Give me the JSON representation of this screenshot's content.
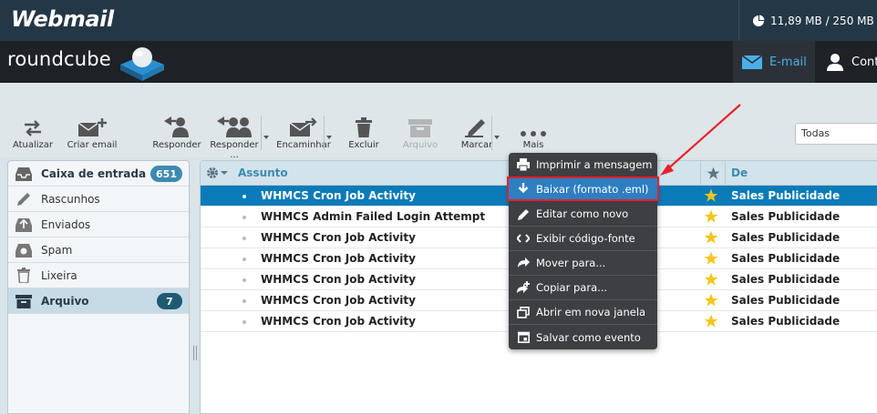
{
  "topbar": {
    "brand": "Webmail",
    "quota": "11,89 MB / 250 MB"
  },
  "header": {
    "logo": "roundcube",
    "nav_mail": "E-mail",
    "nav_contacts": "Cont"
  },
  "toolbar": {
    "refresh": "Atualizar",
    "compose": "Criar email",
    "reply": "Responder",
    "reply_all": "Responder ...",
    "forward": "Encaminhar",
    "delete": "Excluir",
    "archive": "Arquivo",
    "mark": "Marcar",
    "more": "Mais",
    "filter": "Todas"
  },
  "folders": [
    {
      "label": "Caixa de entrada",
      "count": "651",
      "icon": "inbox-icon"
    },
    {
      "label": "Rascunhos",
      "icon": "pencil-icon"
    },
    {
      "label": "Enviados",
      "icon": "sent-icon"
    },
    {
      "label": "Spam",
      "icon": "spam-icon"
    },
    {
      "label": "Lixeira",
      "icon": "trash-icon"
    },
    {
      "label": "Arquivo",
      "count": "7",
      "icon": "archive-icon"
    }
  ],
  "list": {
    "col_subject": "Assunto",
    "col_from": "De",
    "rows": [
      {
        "subject": "WHMCS Cron Job Activity",
        "from": "Sales Publicidade"
      },
      {
        "subject": "WHMCS Admin Failed Login Attempt",
        "from": "Sales Publicidade"
      },
      {
        "subject": "WHMCS Cron Job Activity",
        "from": "Sales Publicidade"
      },
      {
        "subject": "WHMCS Cron Job Activity",
        "from": "Sales Publicidade"
      },
      {
        "subject": "WHMCS Cron Job Activity",
        "from": "Sales Publicidade"
      },
      {
        "subject": "WHMCS Cron Job Activity",
        "from": "Sales Publicidade"
      },
      {
        "subject": "WHMCS Cron Job Activity",
        "from": "Sales Publicidade"
      }
    ]
  },
  "menu": [
    {
      "label": "Imprimir a mensagem",
      "icon": "print-icon"
    },
    {
      "label": "Baixar (formato .eml)",
      "icon": "download-icon"
    },
    {
      "label": "Editar como novo",
      "icon": "edit-icon"
    },
    {
      "label": "Exibir código-fonte",
      "icon": "code-icon"
    },
    {
      "label": "Mover para...",
      "icon": "move-icon"
    },
    {
      "label": "Copiar para...",
      "icon": "copy-icon"
    },
    {
      "label": "Abrir em nova janela",
      "icon": "new-window-icon"
    },
    {
      "label": "Salvar como evento",
      "icon": "calendar-icon"
    }
  ],
  "colors": {
    "accent": "#0a7bb8",
    "highlight_border": "#e8202a",
    "star": "#f5c518"
  }
}
